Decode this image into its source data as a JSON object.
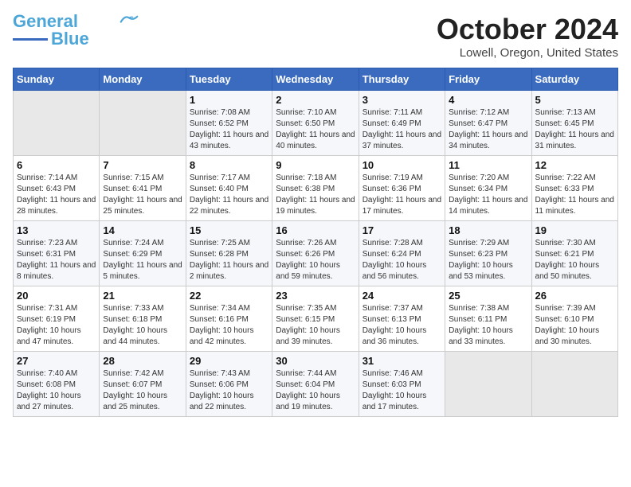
{
  "header": {
    "logo_line1": "General",
    "logo_line2": "Blue",
    "month_title": "October 2024",
    "location": "Lowell, Oregon, United States"
  },
  "weekdays": [
    "Sunday",
    "Monday",
    "Tuesday",
    "Wednesday",
    "Thursday",
    "Friday",
    "Saturday"
  ],
  "weeks": [
    [
      {
        "day": "",
        "sunrise": "",
        "sunset": "",
        "daylight": ""
      },
      {
        "day": "",
        "sunrise": "",
        "sunset": "",
        "daylight": ""
      },
      {
        "day": "1",
        "sunrise": "Sunrise: 7:08 AM",
        "sunset": "Sunset: 6:52 PM",
        "daylight": "Daylight: 11 hours and 43 minutes."
      },
      {
        "day": "2",
        "sunrise": "Sunrise: 7:10 AM",
        "sunset": "Sunset: 6:50 PM",
        "daylight": "Daylight: 11 hours and 40 minutes."
      },
      {
        "day": "3",
        "sunrise": "Sunrise: 7:11 AM",
        "sunset": "Sunset: 6:49 PM",
        "daylight": "Daylight: 11 hours and 37 minutes."
      },
      {
        "day": "4",
        "sunrise": "Sunrise: 7:12 AM",
        "sunset": "Sunset: 6:47 PM",
        "daylight": "Daylight: 11 hours and 34 minutes."
      },
      {
        "day": "5",
        "sunrise": "Sunrise: 7:13 AM",
        "sunset": "Sunset: 6:45 PM",
        "daylight": "Daylight: 11 hours and 31 minutes."
      }
    ],
    [
      {
        "day": "6",
        "sunrise": "Sunrise: 7:14 AM",
        "sunset": "Sunset: 6:43 PM",
        "daylight": "Daylight: 11 hours and 28 minutes."
      },
      {
        "day": "7",
        "sunrise": "Sunrise: 7:15 AM",
        "sunset": "Sunset: 6:41 PM",
        "daylight": "Daylight: 11 hours and 25 minutes."
      },
      {
        "day": "8",
        "sunrise": "Sunrise: 7:17 AM",
        "sunset": "Sunset: 6:40 PM",
        "daylight": "Daylight: 11 hours and 22 minutes."
      },
      {
        "day": "9",
        "sunrise": "Sunrise: 7:18 AM",
        "sunset": "Sunset: 6:38 PM",
        "daylight": "Daylight: 11 hours and 19 minutes."
      },
      {
        "day": "10",
        "sunrise": "Sunrise: 7:19 AM",
        "sunset": "Sunset: 6:36 PM",
        "daylight": "Daylight: 11 hours and 17 minutes."
      },
      {
        "day": "11",
        "sunrise": "Sunrise: 7:20 AM",
        "sunset": "Sunset: 6:34 PM",
        "daylight": "Daylight: 11 hours and 14 minutes."
      },
      {
        "day": "12",
        "sunrise": "Sunrise: 7:22 AM",
        "sunset": "Sunset: 6:33 PM",
        "daylight": "Daylight: 11 hours and 11 minutes."
      }
    ],
    [
      {
        "day": "13",
        "sunrise": "Sunrise: 7:23 AM",
        "sunset": "Sunset: 6:31 PM",
        "daylight": "Daylight: 11 hours and 8 minutes."
      },
      {
        "day": "14",
        "sunrise": "Sunrise: 7:24 AM",
        "sunset": "Sunset: 6:29 PM",
        "daylight": "Daylight: 11 hours and 5 minutes."
      },
      {
        "day": "15",
        "sunrise": "Sunrise: 7:25 AM",
        "sunset": "Sunset: 6:28 PM",
        "daylight": "Daylight: 11 hours and 2 minutes."
      },
      {
        "day": "16",
        "sunrise": "Sunrise: 7:26 AM",
        "sunset": "Sunset: 6:26 PM",
        "daylight": "Daylight: 10 hours and 59 minutes."
      },
      {
        "day": "17",
        "sunrise": "Sunrise: 7:28 AM",
        "sunset": "Sunset: 6:24 PM",
        "daylight": "Daylight: 10 hours and 56 minutes."
      },
      {
        "day": "18",
        "sunrise": "Sunrise: 7:29 AM",
        "sunset": "Sunset: 6:23 PM",
        "daylight": "Daylight: 10 hours and 53 minutes."
      },
      {
        "day": "19",
        "sunrise": "Sunrise: 7:30 AM",
        "sunset": "Sunset: 6:21 PM",
        "daylight": "Daylight: 10 hours and 50 minutes."
      }
    ],
    [
      {
        "day": "20",
        "sunrise": "Sunrise: 7:31 AM",
        "sunset": "Sunset: 6:19 PM",
        "daylight": "Daylight: 10 hours and 47 minutes."
      },
      {
        "day": "21",
        "sunrise": "Sunrise: 7:33 AM",
        "sunset": "Sunset: 6:18 PM",
        "daylight": "Daylight: 10 hours and 44 minutes."
      },
      {
        "day": "22",
        "sunrise": "Sunrise: 7:34 AM",
        "sunset": "Sunset: 6:16 PM",
        "daylight": "Daylight: 10 hours and 42 minutes."
      },
      {
        "day": "23",
        "sunrise": "Sunrise: 7:35 AM",
        "sunset": "Sunset: 6:15 PM",
        "daylight": "Daylight: 10 hours and 39 minutes."
      },
      {
        "day": "24",
        "sunrise": "Sunrise: 7:37 AM",
        "sunset": "Sunset: 6:13 PM",
        "daylight": "Daylight: 10 hours and 36 minutes."
      },
      {
        "day": "25",
        "sunrise": "Sunrise: 7:38 AM",
        "sunset": "Sunset: 6:11 PM",
        "daylight": "Daylight: 10 hours and 33 minutes."
      },
      {
        "day": "26",
        "sunrise": "Sunrise: 7:39 AM",
        "sunset": "Sunset: 6:10 PM",
        "daylight": "Daylight: 10 hours and 30 minutes."
      }
    ],
    [
      {
        "day": "27",
        "sunrise": "Sunrise: 7:40 AM",
        "sunset": "Sunset: 6:08 PM",
        "daylight": "Daylight: 10 hours and 27 minutes."
      },
      {
        "day": "28",
        "sunrise": "Sunrise: 7:42 AM",
        "sunset": "Sunset: 6:07 PM",
        "daylight": "Daylight: 10 hours and 25 minutes."
      },
      {
        "day": "29",
        "sunrise": "Sunrise: 7:43 AM",
        "sunset": "Sunset: 6:06 PM",
        "daylight": "Daylight: 10 hours and 22 minutes."
      },
      {
        "day": "30",
        "sunrise": "Sunrise: 7:44 AM",
        "sunset": "Sunset: 6:04 PM",
        "daylight": "Daylight: 10 hours and 19 minutes."
      },
      {
        "day": "31",
        "sunrise": "Sunrise: 7:46 AM",
        "sunset": "Sunset: 6:03 PM",
        "daylight": "Daylight: 10 hours and 17 minutes."
      },
      {
        "day": "",
        "sunrise": "",
        "sunset": "",
        "daylight": ""
      },
      {
        "day": "",
        "sunrise": "",
        "sunset": "",
        "daylight": ""
      }
    ]
  ]
}
